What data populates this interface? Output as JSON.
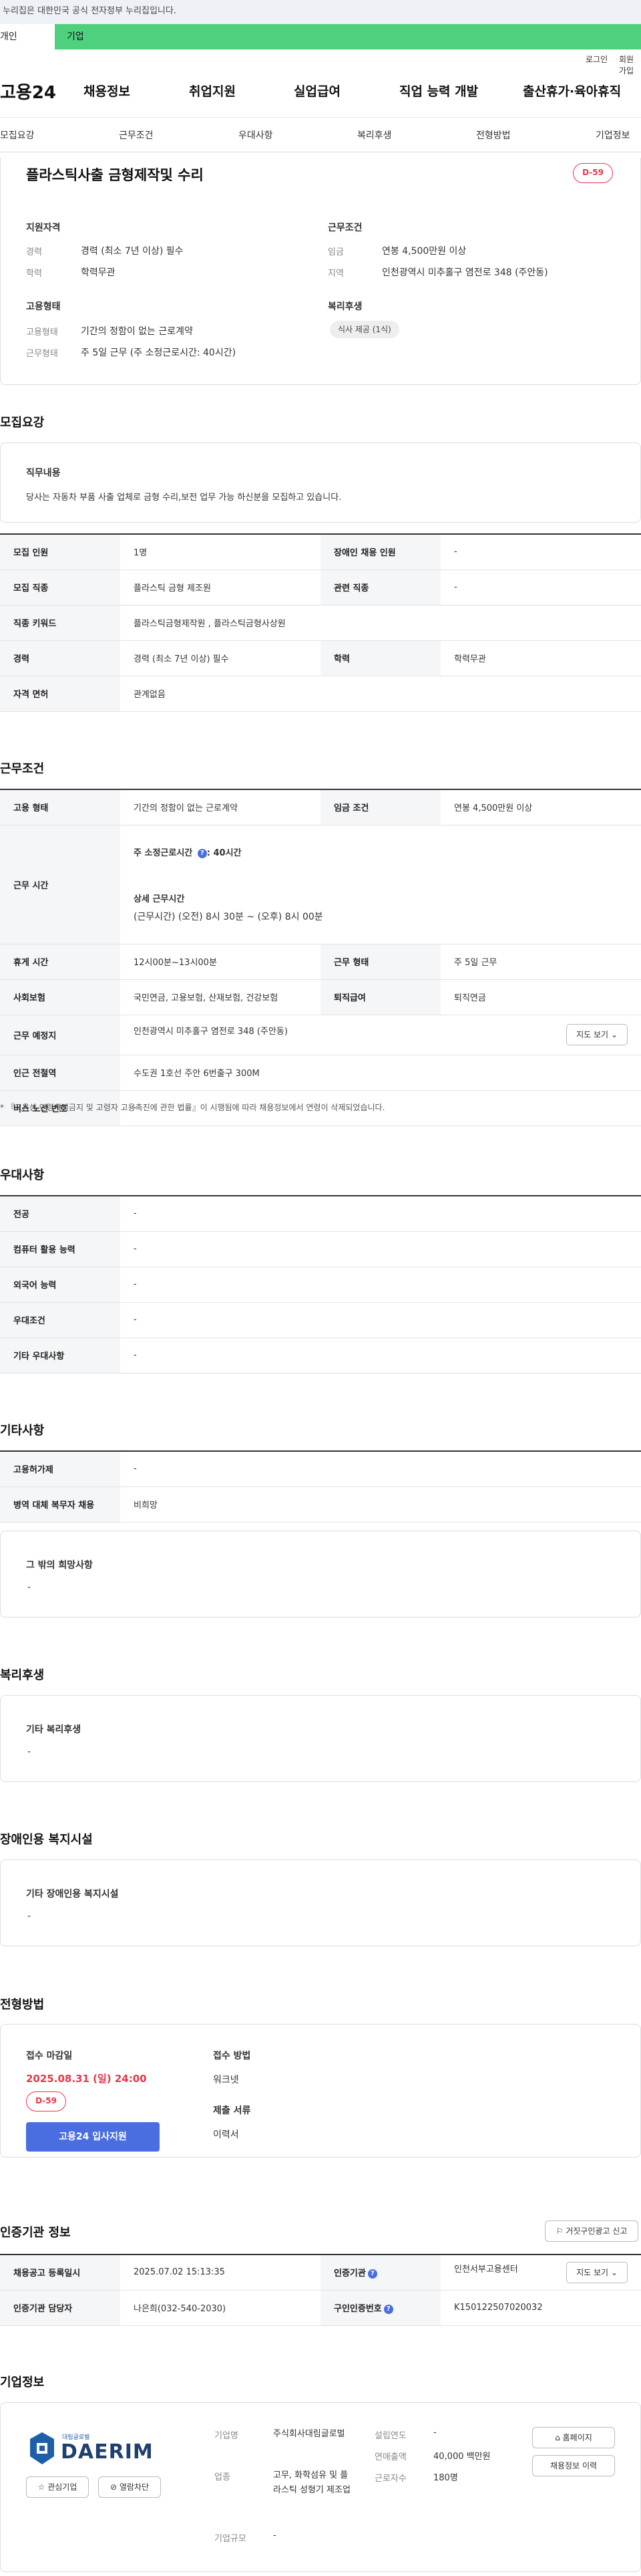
{
  "top_notice": "이 누리집은 대한민국 공식 전자정부 누리집입니다.",
  "gov_tabs": {
    "active": "개인",
    "corp": "기업"
  },
  "util": {
    "login": "로그인",
    "join": "회원가입"
  },
  "gnb": {
    "logo": "고용24",
    "menu": [
      "채용정보",
      "취업지원",
      "실업급여",
      "직업 능력 개발",
      "출산휴가·육아휴직"
    ]
  },
  "lnb": [
    "모집요강",
    "근무조건",
    "우대사항",
    "복리후생",
    "전형방법",
    "기업정보"
  ],
  "job": {
    "title": "플라스틱사출 금형제작및 수리",
    "dday": "D-59",
    "req_title": "지원자격",
    "career_label": "경력",
    "career_value": "경력 (최소 7년 이상) 필수",
    "edu_label": "학력",
    "edu_value": "학력무관",
    "work_title": "근무조건",
    "wage_label": "임금",
    "wage_value": "연봉 4,500만원 이상",
    "region_label": "지역",
    "region_value": "인천광역시 미추홀구 염전로 348 (주안동)",
    "emp_title": "고용형태",
    "emp_label": "고용형태",
    "emp_value": "기간의 정함이 없는 근로계약",
    "shift_label": "근무형태",
    "shift_value": "주 5일 근무 (주 소정근로시간: 40시간)",
    "welfare_title": "복리후생",
    "welfare_chip": "식사 제공 (1식)"
  },
  "recruit": {
    "heading": "모집요강",
    "duty_title": "직무내용",
    "duty_text": "당사는 자동차 부품 사출 업체로 금형 수리,보전 업무 가능 하신분을 모집하고 있습니다.",
    "rows": [
      {
        "k1": "모집 인원",
        "v1": "1명",
        "k2": "장애인 채용 인원",
        "v2": "-"
      },
      {
        "k1": "모집 직종",
        "v1": "플라스틱 금형 제조원",
        "k2": "관련 직종",
        "v2": "-"
      },
      {
        "k1": "직종 키워드",
        "v1": "플라스틱금형제작원 , 플라스틱금형사상원"
      },
      {
        "k1": "경력",
        "v1": "경력 (최소 7년 이상) 필수",
        "k2": "학력",
        "v2": "학력무관"
      },
      {
        "k1": "자격 면허",
        "v1": "관계없음"
      }
    ]
  },
  "cond": {
    "heading": "근무조건",
    "emp_k": "고용 형태",
    "emp_v": "기간의 정함이 없는 근로계약",
    "wage_k": "임금 조건",
    "wage_v": "연봉 4,500만원 이상",
    "hours_k": "근무 시간",
    "hours_week": "주 소정근로시간",
    "hours_week_val": ": 40시간",
    "hours_detail_title": "상세 근무시간",
    "hours_detail": "(근무시간) (오전) 8시 30분 ~ (오후) 8시 00분",
    "break_k": "휴게 시간",
    "break_v": "12시00분~13시00분",
    "shift_k": "근무 형태",
    "shift_v": "주 5일 근무",
    "ins_k": "사회보험",
    "ins_v": "국민연금, 고용보험, 산재보험, 건강보험",
    "retire_k": "퇴직급여",
    "retire_v": "퇴직연금",
    "place_k": "근무 예정지",
    "place_v": "인천광역시 미추홀구 염전로 348 (주안동)",
    "map_btn": "지도 보기",
    "subway_k": "인근 전철역",
    "subway_v": "수도권 1호선 주안 6번출구 300M",
    "bus_k": "버스 노선 번호",
    "bus_v": "-",
    "note": "* 『고용상 연령차별금지 및 고령자 고용촉진에 관한 법률』이 시행됨에 따라 채용정보에서 연령이 삭제되었습니다."
  },
  "pref": {
    "heading": "우대사항",
    "rows": [
      {
        "k": "전공",
        "v": "-"
      },
      {
        "k": "컴퓨터 활용 능력",
        "v": "-"
      },
      {
        "k": "외국어 능력",
        "v": "-"
      },
      {
        "k": "우대조건",
        "v": "-"
      },
      {
        "k": "기타 우대사항",
        "v": "-"
      }
    ]
  },
  "etc": {
    "heading": "기타사항",
    "rows": [
      {
        "k": "고용허가제",
        "v": "-"
      },
      {
        "k": "병역 대체 복무자 채용",
        "v": "비희망"
      }
    ],
    "wish_title": "그 밖의 희망사항",
    "wish_value": "-"
  },
  "welfare": {
    "heading": "복리후생",
    "box_title": "기타 복리후생",
    "box_value": "-"
  },
  "disabled": {
    "heading": "장애인용 복지시설",
    "box_title": "기타 장애인용 복지시설",
    "box_value": "-"
  },
  "process": {
    "heading": "전형방법",
    "deadline_label": "접수 마감일",
    "deadline": "2025.08.31 (일) 24:00",
    "dday": "D-59",
    "apply_btn": "고용24 입사지원",
    "method_label": "접수 방법",
    "method": "워크넷",
    "docs_label": "제출 서류",
    "docs": "이력서"
  },
  "cert": {
    "heading": "인증기관 정보",
    "report_btn": "거짓구인광고 신고",
    "reg_k": "채용공고 등록일시",
    "reg_v": "2025.07.02 15:13:35",
    "org_k": "인증기관",
    "org_v": "인천서부고용센터",
    "map_btn": "지도 보기",
    "mgr_k": "인증기관 담당자",
    "mgr_v": "나은희(032-540-2030)",
    "num_k": "구인인증번호",
    "num_v": "K150122507020032"
  },
  "company": {
    "heading": "기업정보",
    "logo_small": "대림글로벌",
    "logo_text": "DAERIM",
    "fav_btn": "관심기업",
    "block_btn": "열람차단",
    "name_k": "기업명",
    "name_v": "주식회사대림글로벌",
    "biz_k": "업종",
    "biz_v": "고무, 화학섬유 및 플라스틱 성형기 제조업",
    "size_k": "기업규모",
    "size_v": "-",
    "year_k": "설립연도",
    "year_v": "-",
    "sales_k": "연매출액",
    "sales_v": "40,000 백만원",
    "emp_k": "근로자수",
    "emp_v": "180명",
    "home_btn": "홈페이지",
    "other_btn": "채용정보 이력"
  },
  "colors": {
    "accent": "#4a6ee0",
    "dday": "#e5364a",
    "gov_green": "#4fd07f"
  }
}
